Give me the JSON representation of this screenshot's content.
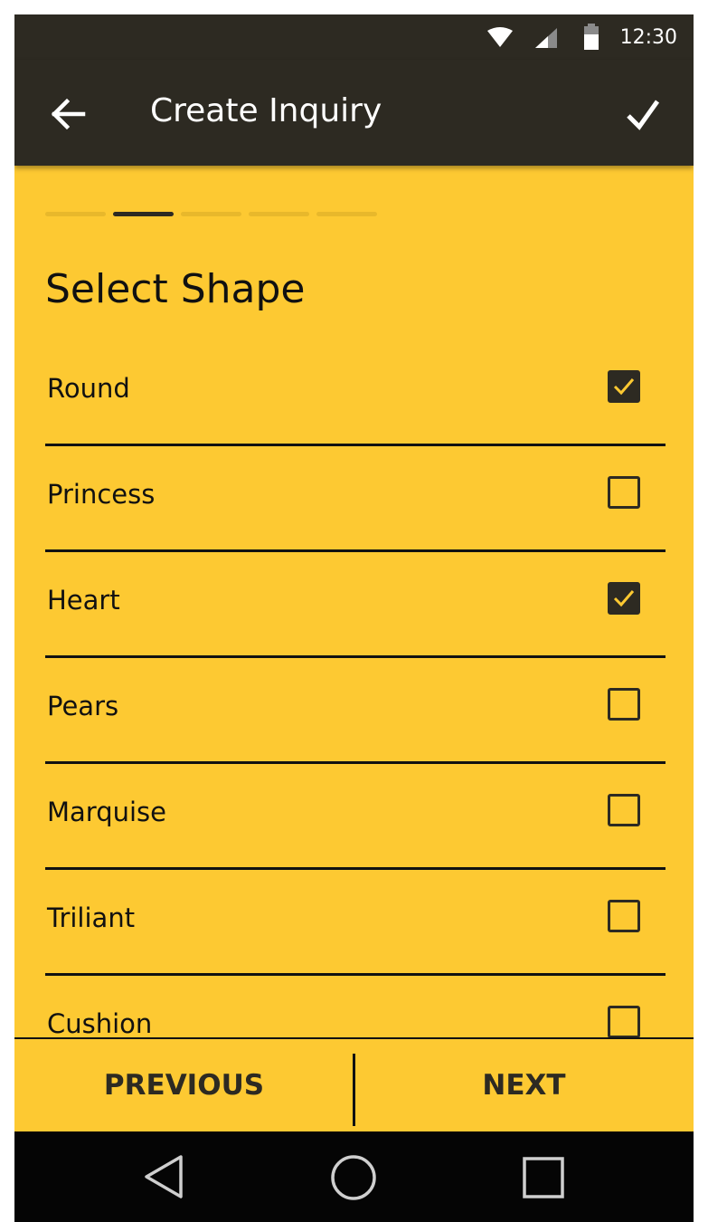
{
  "status_bar": {
    "time": "12:30",
    "icons": [
      "wifi-icon",
      "signal-icon",
      "battery-icon"
    ]
  },
  "app_bar": {
    "title": "Create Inquiry",
    "back_icon": "arrow-left-icon",
    "confirm_icon": "check-icon"
  },
  "progress": {
    "steps": 5,
    "current_step": 2
  },
  "section": {
    "title": "Select Shape"
  },
  "shapes": [
    {
      "label": "Round",
      "checked": true
    },
    {
      "label": "Princess",
      "checked": false
    },
    {
      "label": "Heart",
      "checked": true
    },
    {
      "label": "Pears",
      "checked": false
    },
    {
      "label": "Marquise",
      "checked": false
    },
    {
      "label": "Triliant",
      "checked": false
    },
    {
      "label": "Cushion",
      "checked": false
    }
  ],
  "bottom_bar": {
    "previous_label": "PREVIOUS",
    "next_label": "NEXT"
  },
  "nav_bar": {
    "icons": [
      "triangle-back-icon",
      "circle-home-icon",
      "square-recents-icon"
    ]
  },
  "colors": {
    "accent": "#FDC932",
    "dark": "#2D2A22",
    "progress_inactive": "#E8B82B"
  }
}
